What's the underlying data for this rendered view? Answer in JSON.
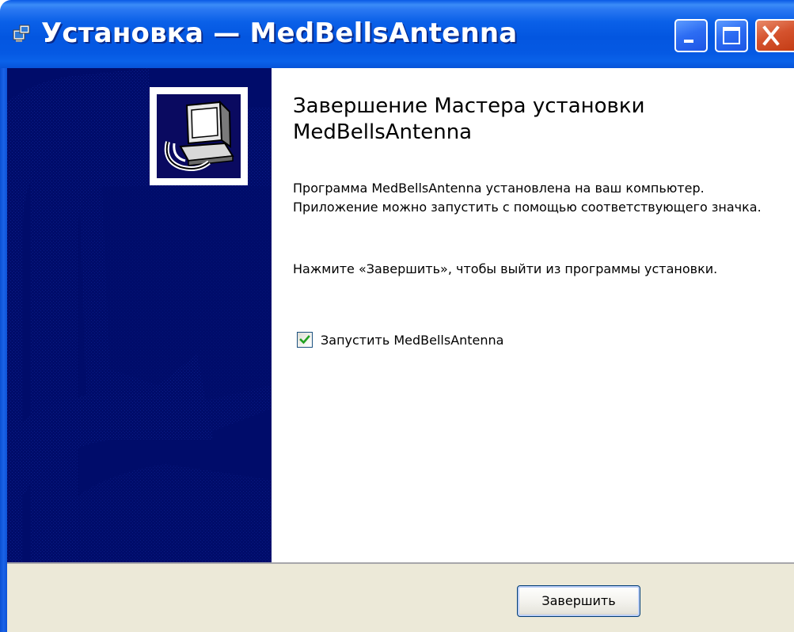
{
  "window": {
    "title": "Установка — MedBellsAntenna",
    "controls": [
      "minimize",
      "maximize",
      "close"
    ]
  },
  "icons": {
    "app_icon": "installer-app-icon",
    "setup_icon": "computer-setup-icon",
    "minimize": "minimize-icon",
    "maximize": "maximize-icon",
    "close": "close-icon",
    "checkmark": "checkmark-icon"
  },
  "wizard": {
    "heading": "Завершение Мастера установки MedBellsAntenna",
    "paragraph1": "Программа MedBellsAntenna установлена на ваш компьютер. Приложение можно запустить с помощью соответствующего значка.",
    "paragraph2": "Нажмите «Завершить», чтобы выйти из программы установки.",
    "launch_checkbox": {
      "label": "Запустить MedBellsAntenna",
      "checked": true
    }
  },
  "buttons": {
    "finish_label": "Завершить"
  },
  "colors": {
    "titlebar_blue": "#0356e0",
    "side_panel_navy": "#000c6a",
    "dialog_face": "#ece9d8",
    "close_red": "#d5532e",
    "check_green": "#21a121"
  }
}
